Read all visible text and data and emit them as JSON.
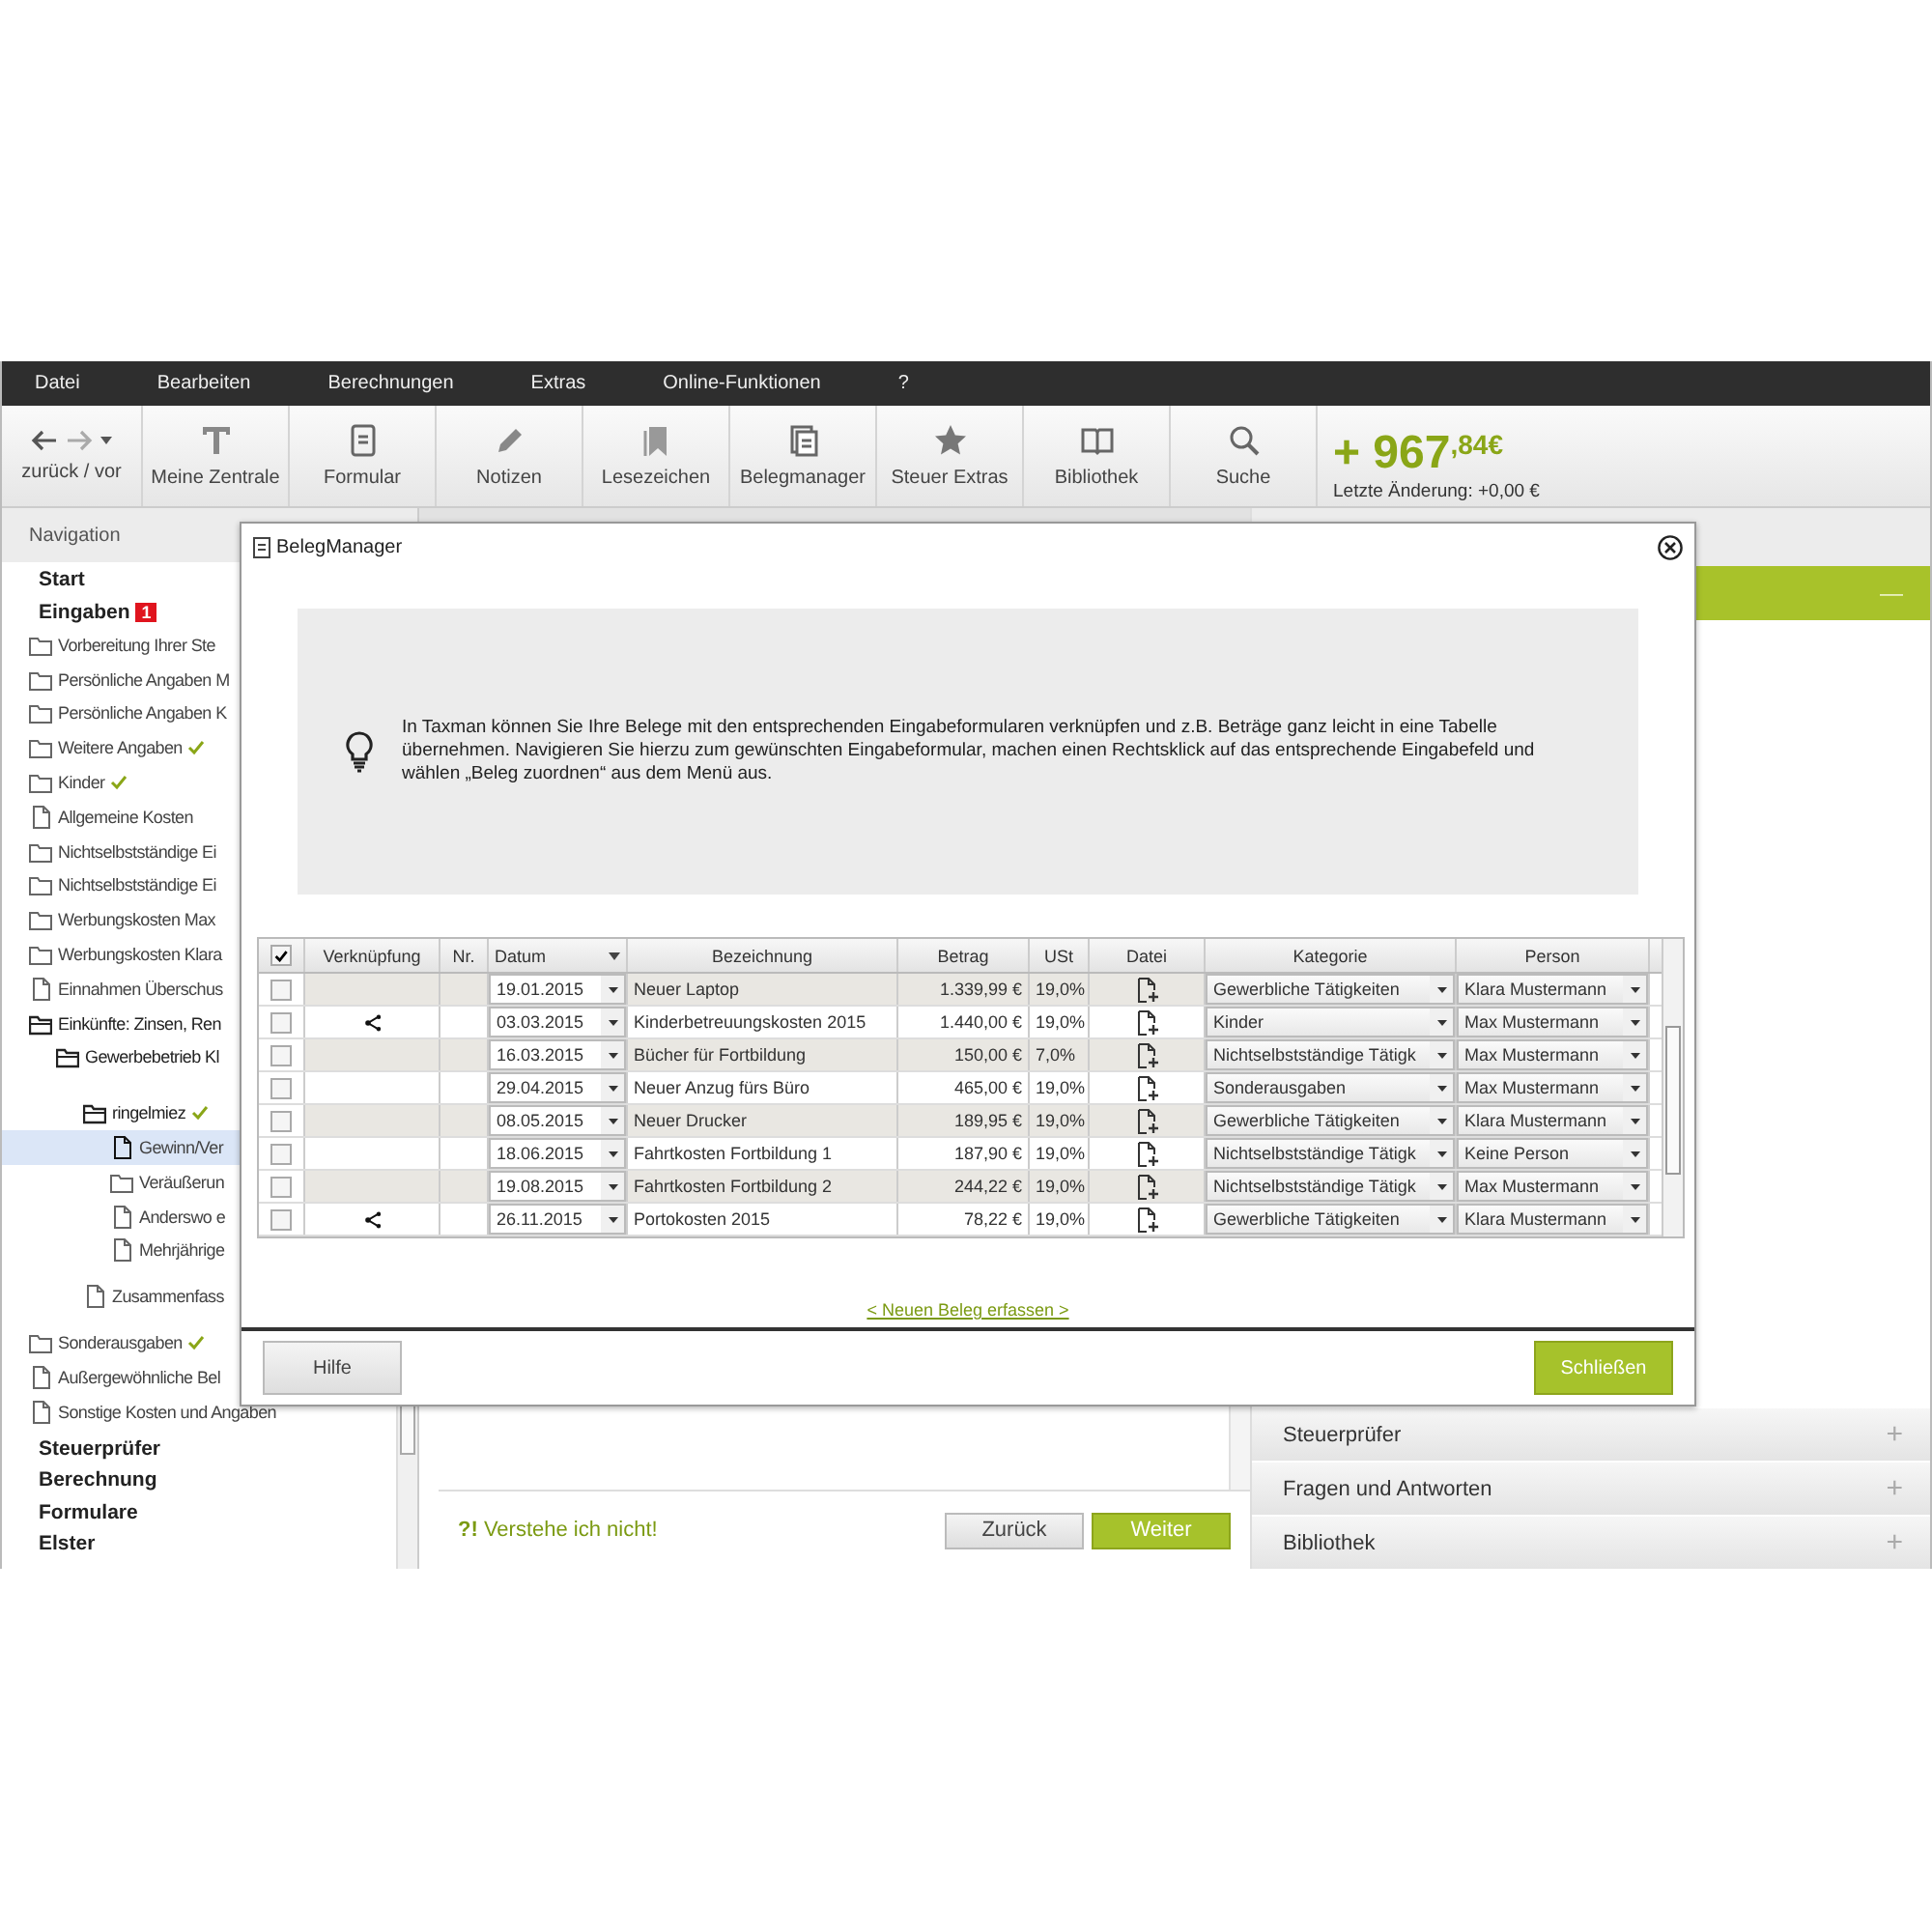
{
  "menu": [
    "Datei",
    "Bearbeiten",
    "Berechnungen",
    "Extras",
    "Online-Funktionen",
    "?"
  ],
  "toolbar": {
    "nav_label": "zurück / vor",
    "items": [
      {
        "label": "Meine Zentrale",
        "kind": "text"
      },
      {
        "label": "Formular",
        "kind": "form"
      },
      {
        "label": "Notizen",
        "kind": "pencil"
      },
      {
        "label": "Lesezeichen",
        "kind": "bookmark"
      },
      {
        "label": "Belegmanager",
        "kind": "documents"
      },
      {
        "label": "Steuer Extras",
        "kind": "star"
      },
      {
        "label": "Bibliothek",
        "kind": "book"
      },
      {
        "label": "Suche",
        "kind": "search"
      }
    ]
  },
  "balance": {
    "amount": "+ 967$^{,84€}$",
    "change": "Letzte Änderung: +0,00 €"
  },
  "sidebar": {
    "title": "Navigation",
    "items": [
      {
        "label": "Start",
        "kind": "section",
        "selected": false
      },
      {
        "label": "Eingaben",
        "kind": "section",
        "selected": false,
        "badge": "1",
        "children": [
          {
            "label": "Vorbereitung Ihrer Ste",
            "kind": "folder",
            "done": false,
            "selected": false
          },
          {
            "label": "Persönliche Angaben M",
            "kind": "folder",
            "done": false,
            "selected": false
          },
          {
            "label": "Persönliche Angaben K",
            "kind": "folder",
            "done": false,
            "selected": false
          },
          {
            "label": "Weitere Angaben",
            "kind": "folder",
            "done": true,
            "selected": false
          },
          {
            "label": "Kinder",
            "kind": "folder",
            "done": true,
            "selected": false
          },
          {
            "label": "Allgemeine Kosten",
            "kind": "doc",
            "done": false,
            "selected": false
          },
          {
            "label": "Nichtselbstständige Ei",
            "kind": "folder",
            "done": false,
            "selected": false
          },
          {
            "label": "Nichtselbstständige Ei",
            "kind": "folder",
            "done": false,
            "selected": false
          },
          {
            "label": "Werbungskosten Max",
            "kind": "folder",
            "done": false,
            "selected": false
          },
          {
            "label": "Werbungskosten Klara",
            "kind": "folder",
            "done": false,
            "selected": false
          },
          {
            "label": "Einnahmen Überschus",
            "kind": "doc",
            "done": false,
            "selected": false
          },
          {
            "label": "Einkünfte: Zinsen, Ren",
            "kind": "folder-open",
            "done": false,
            "selected": false,
            "children": [
              {
                "label": "Gewerbebetrieb Kl",
                "kind": "folder-open",
                "done": false,
                "selected": false,
                "children": [
                  {
                    "label": "ringelmiez",
                    "kind": "folder-open",
                    "done": true,
                    "selected": false,
                    "children": [
                      {
                        "label": "Gewinn/Ver",
                        "kind": "doc",
                        "done": false,
                        "selected": true
                      },
                      {
                        "label": "Veräußerun",
                        "kind": "folder",
                        "done": false,
                        "selected": false
                      },
                      {
                        "label": "Anderswo e",
                        "kind": "doc",
                        "done": false,
                        "selected": false
                      },
                      {
                        "label": "Mehrjährige",
                        "kind": "doc",
                        "done": false,
                        "selected": false
                      }
                    ]
                  },
                  {
                    "label": "Zusammenfass",
                    "kind": "doc",
                    "done": false,
                    "selected": false
                  }
                ]
              }
            ]
          },
          {
            "label": "Sonderausgaben",
            "kind": "folder",
            "done": true,
            "selected": false
          },
          {
            "label": "Außergewöhnliche Bel",
            "kind": "doc",
            "done": false,
            "selected": false
          },
          {
            "label": "Sonstige Kosten und Angaben",
            "kind": "doc",
            "done": false,
            "selected": false
          }
        ]
      },
      {
        "label": "Steuerprüfer",
        "kind": "section",
        "selected": false
      },
      {
        "label": "Berechnung",
        "kind": "section",
        "selected": false
      },
      {
        "label": "Formulare",
        "kind": "section",
        "selected": false
      },
      {
        "label": "Elster",
        "kind": "section",
        "selected": false
      }
    ]
  },
  "center": {
    "help": "**?!** Verstehe ich nicht!",
    "buttons": [
      {
        "label": "Zurück",
        "kind": "secondary"
      },
      {
        "label": "Weiter",
        "kind": "primary"
      }
    ]
  },
  "right_panel": {
    "open_section": {
      "toggle": "—"
    },
    "sections": [
      {
        "label": "Steuerprüfer",
        "toggle": "+"
      },
      {
        "label": "Fragen und Antworten",
        "toggle": "+"
      },
      {
        "label": "Bibliothek",
        "toggle": "+"
      }
    ]
  },
  "dialog": {
    "title": "BelegManager",
    "info": "In Taxman können Sie Ihre Belege mit den entsprechenden Eingabeformularen verknüpfen und z.B. Beträge ganz leicht in eine Tabelle übernehmen. Navigieren Sie hierzu zum gewünschten Eingabeformular, machen einen Rechtsklick auf das entsprechende Eingabefeld und wählen „Beleg zuordnen“ aus dem Menü aus.",
    "table": {
      "header_checked": true,
      "columns": [
        "Verknüpfung",
        "Nr.",
        "Datum",
        "Bezeichnung",
        "Betrag",
        "USt",
        "Datei",
        "Kategorie",
        "Person"
      ],
      "rows": [
        {
          "checked": false,
          "linked": false,
          "date": "19.01.2015",
          "description": "Neuer Laptop",
          "amount": "1.339,99 €",
          "vat": "19,0%",
          "category": "Gewerbliche Tätigkeiten",
          "person": "Klara Mustermann"
        },
        {
          "checked": false,
          "linked": true,
          "date": "03.03.2015",
          "description": "Kinderbetreuungskosten 2015",
          "amount": "1.440,00 €",
          "vat": "19,0%",
          "category": "Kinder",
          "person": "Max Mustermann"
        },
        {
          "checked": false,
          "linked": false,
          "date": "16.03.2015",
          "description": "Bücher für Fortbildung",
          "amount": "150,00 €",
          "vat": "7,0%",
          "category": "Nichtselbstständige Tätigk",
          "person": "Max Mustermann"
        },
        {
          "checked": false,
          "linked": false,
          "date": "29.04.2015",
          "description": "Neuer Anzug fürs Büro",
          "amount": "465,00 €",
          "vat": "19,0%",
          "category": "Sonderausgaben",
          "person": "Max Mustermann"
        },
        {
          "checked": false,
          "linked": false,
          "date": "08.05.2015",
          "description": "Neuer Drucker",
          "amount": "189,95 €",
          "vat": "19,0%",
          "category": "Gewerbliche Tätigkeiten",
          "person": "Klara Mustermann"
        },
        {
          "checked": false,
          "linked": false,
          "date": "18.06.2015",
          "description": "Fahrtkosten Fortbildung 1",
          "amount": "187,90 €",
          "vat": "19,0%",
          "category": "Nichtselbstständige Tätigk",
          "person": "Keine Person"
        },
        {
          "checked": false,
          "linked": false,
          "date": "19.08.2015",
          "description": "Fahrtkosten Fortbildung 2",
          "amount": "244,22 €",
          "vat": "19,0%",
          "category": "Nichtselbstständige Tätigk",
          "person": "Max Mustermann"
        },
        {
          "checked": false,
          "linked": true,
          "date": "26.11.2015",
          "description": "Portokosten 2015",
          "amount": "78,22 €",
          "vat": "19,0%",
          "category": "Gewerbliche Tätigkeiten",
          "person": "Klara Mustermann"
        }
      ]
    },
    "link": "< Neuen Beleg erfassen >",
    "buttons": [
      {
        "label": "Hilfe",
        "kind": "secondary"
      },
      {
        "label": "Schließen",
        "kind": "primary"
      }
    ]
  }
}
